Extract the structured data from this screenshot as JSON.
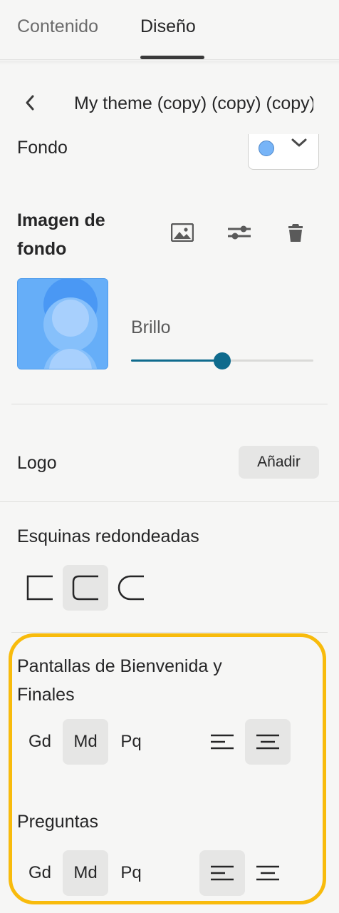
{
  "tabs": [
    {
      "label": "Contenido",
      "active": false
    },
    {
      "label": "Diseño",
      "active": true
    }
  ],
  "theme": {
    "name": "My theme (copy) (copy) (copy)"
  },
  "background": {
    "label": "Fondo",
    "color": "#77b4f7",
    "image_label": "Imagen de fondo",
    "icons": [
      "image-icon",
      "adjust-sliders-icon",
      "trash-icon"
    ],
    "brightness_label": "Brillo",
    "brightness_fraction": 0.5
  },
  "logo": {
    "label": "Logo",
    "add_label": "Añadir"
  },
  "corners": {
    "label": "Esquinas redondeadas",
    "options": [
      "square",
      "rounded",
      "pill"
    ],
    "selected": "rounded"
  },
  "welcome_screens": {
    "label": "Pantallas de Bienvenida y Finales",
    "sizes": [
      "Gd",
      "Md",
      "Pq"
    ],
    "selected_size": "Md",
    "alignment_options": [
      "left",
      "center"
    ],
    "selected_alignment": "center"
  },
  "questions": {
    "label": "Preguntas",
    "sizes": [
      "Gd",
      "Md",
      "Pq"
    ],
    "selected_size": "Md",
    "alignment_options": [
      "left",
      "center"
    ],
    "selected_alignment": "left"
  },
  "colors": {
    "accent": "#0f6b8d",
    "highlight": "#f8bb0c",
    "thumbnail": "#66aef8"
  }
}
